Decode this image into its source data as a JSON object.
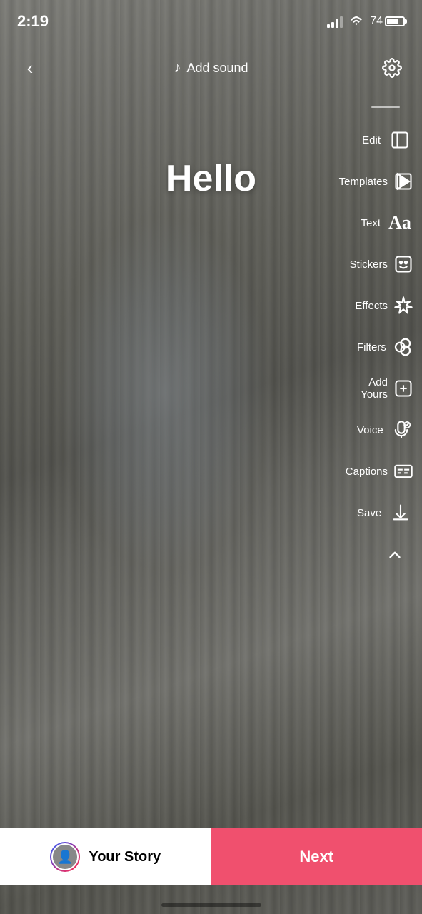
{
  "statusBar": {
    "time": "2:19",
    "battery": "74"
  },
  "header": {
    "addSound": "Add sound",
    "backLabel": "‹"
  },
  "canvas": {
    "helloText": "Hello"
  },
  "toolbar": {
    "dividerVisible": true,
    "items": [
      {
        "id": "edit",
        "label": "Edit",
        "icon": "edit"
      },
      {
        "id": "templates",
        "label": "Templates",
        "icon": "templates"
      },
      {
        "id": "text",
        "label": "Text",
        "icon": "text"
      },
      {
        "id": "stickers",
        "label": "Stickers",
        "icon": "stickers"
      },
      {
        "id": "effects",
        "label": "Effects",
        "icon": "effects"
      },
      {
        "id": "filters",
        "label": "Filters",
        "icon": "filters"
      },
      {
        "id": "add-yours",
        "label": "Add Yours",
        "icon": "add-yours"
      },
      {
        "id": "voice",
        "label": "Voice",
        "icon": "voice"
      },
      {
        "id": "captions",
        "label": "Captions",
        "icon": "captions"
      },
      {
        "id": "save",
        "label": "Save",
        "icon": "save"
      }
    ]
  },
  "bottomBar": {
    "yourStoryLabel": "Your Story",
    "nextLabel": "Next"
  }
}
